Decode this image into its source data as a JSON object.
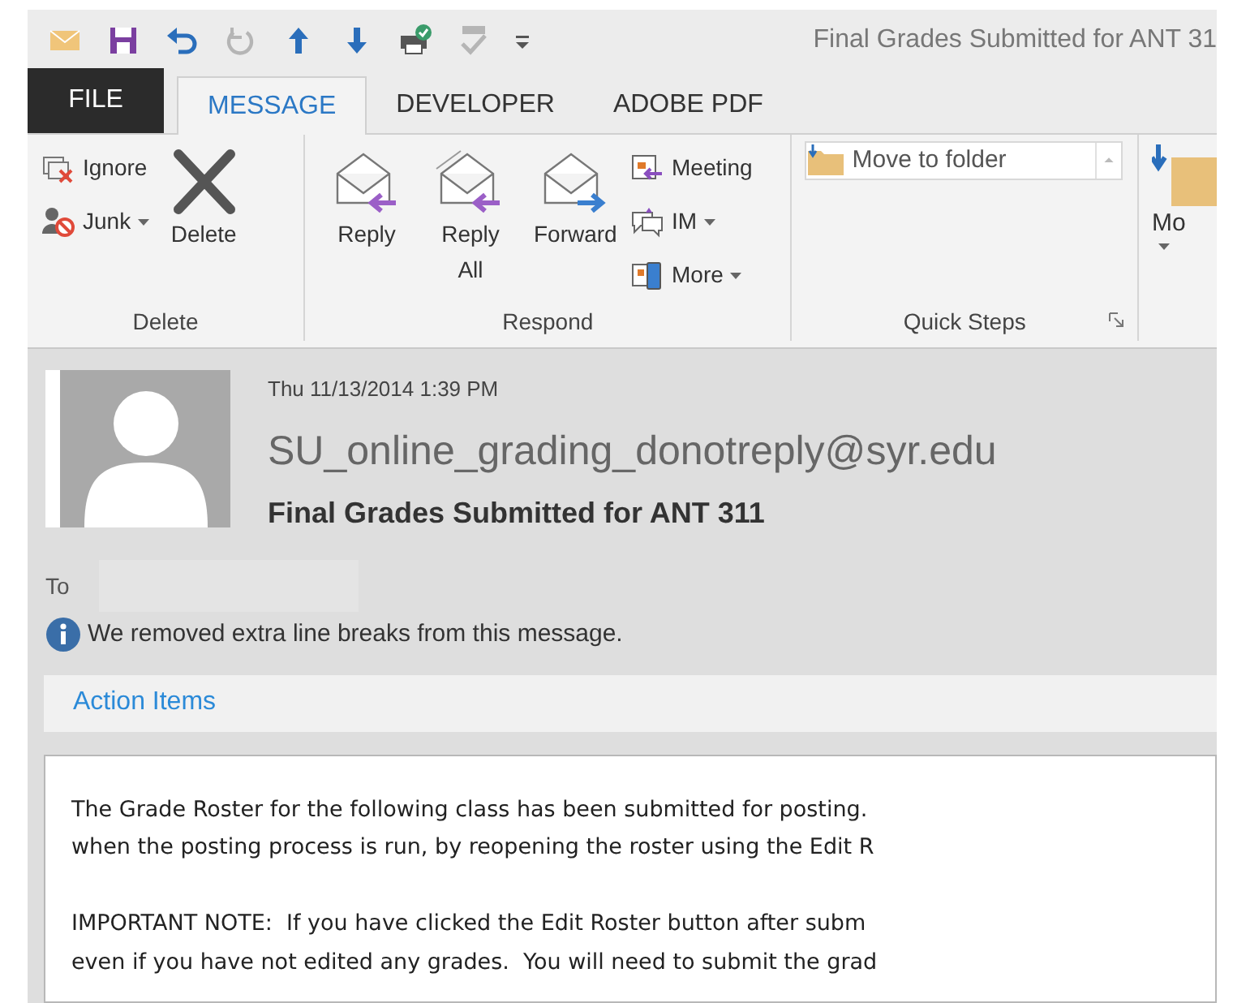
{
  "quick_access": [
    {
      "disabled": false
    },
    {
      "disabled": false
    },
    {
      "disabled": false
    },
    {
      "disabled": true
    },
    {
      "disabled": false
    },
    {
      "disabled": false
    },
    {
      "disabled": false
    },
    {
      "disabled": true
    },
    {
      "disabled": false
    }
  ],
  "window": {
    "title": "Final Grades Submitted for ANT 31"
  },
  "tabs": [
    {
      "label": "FILE",
      "kind": "file",
      "selected": false
    },
    {
      "label": "MESSAGE",
      "kind": "tab",
      "selected": true
    },
    {
      "label": "DEVELOPER",
      "kind": "tab",
      "selected": false
    },
    {
      "label": "ADOBE PDF",
      "kind": "tab",
      "selected": false
    }
  ],
  "ribbon": {
    "groups": [
      {
        "label": "Delete",
        "small": [
          {
            "label": "Ignore",
            "dropdown": false
          },
          {
            "label": "Junk",
            "dropdown": true
          }
        ],
        "large": [
          {
            "label": "Delete"
          }
        ]
      },
      {
        "label": "Respond",
        "large": [
          {
            "label": "Reply"
          },
          {
            "label": "Reply All"
          },
          {
            "label": "Forward"
          }
        ],
        "small": [
          {
            "label": "Meeting",
            "dropdown": false
          },
          {
            "label": "IM",
            "dropdown": true
          },
          {
            "label": "More",
            "dropdown": true
          }
        ]
      },
      {
        "label": "Quick Steps",
        "quick_step": "Move to folder"
      }
    ],
    "cut_button": "Mo"
  },
  "message": {
    "date": "Thu 11/13/2014 1:39 PM",
    "sender": "SU_online_grading_donotreply@syr.edu",
    "subject": "Final Grades Submitted for ANT 311",
    "to_label": "To",
    "notice": "We removed extra line breaks from this message.",
    "action_items": "Action Items"
  },
  "body": {
    "paragraphs": [
      {
        "lines": [
          "The Grade Roster for the following class has been submitted for posting.",
          "when the posting process is run, by reopening the roster using the Edit R"
        ]
      },
      {
        "lines": [
          "IMPORTANT NOTE:  If you have clicked the Edit Roster button after subm",
          "even if you have not edited any grades.  You will need to submit the grad"
        ]
      }
    ]
  }
}
